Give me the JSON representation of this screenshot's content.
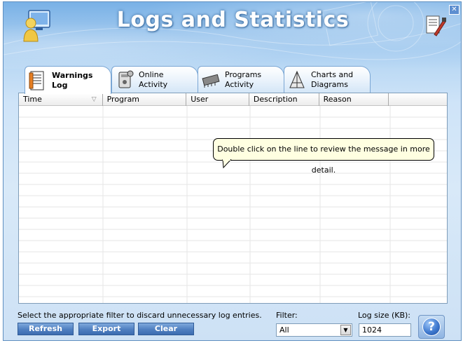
{
  "window": {
    "title": "Logs and Statistics",
    "close_symbol": "✕",
    "accent": "#4f7fc0"
  },
  "tabs": [
    {
      "line1": "Warnings",
      "line2": "Log",
      "icon": "warnings-log-icon",
      "active": true
    },
    {
      "line1": "Online",
      "line2": "Activity",
      "icon": "online-activity-icon",
      "active": false
    },
    {
      "line1": "Programs",
      "line2": "Activity",
      "icon": "programs-activity-icon",
      "active": false
    },
    {
      "line1": "Charts and",
      "line2": "Diagrams",
      "icon": "charts-diagrams-icon",
      "active": false
    }
  ],
  "table": {
    "columns": [
      "Time",
      "Program",
      "User",
      "Description",
      "Reason",
      ""
    ],
    "sort_indicator": "▽",
    "rows": []
  },
  "tooltip": {
    "text": "Double click on the line to review the message in more detail."
  },
  "footer": {
    "hint": "Select the appropriate filter to discard unnecessary log entries.",
    "refresh_label": "Refresh",
    "export_label": "Export",
    "clear_label": "Clear",
    "filter_label": "Filter:",
    "filter_value": "All",
    "log_size_label": "Log size (KB):",
    "log_size_value": "1024",
    "help_symbol": "?"
  }
}
